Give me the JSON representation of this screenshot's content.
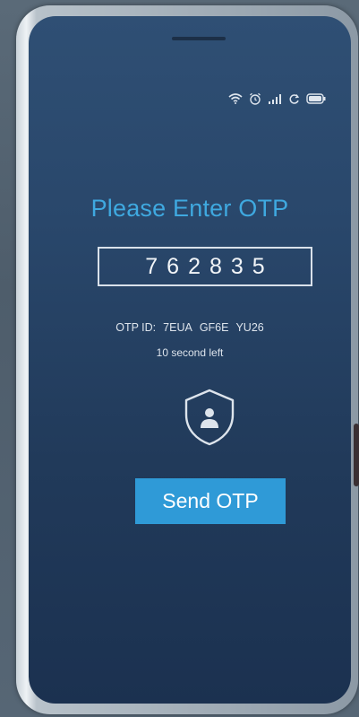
{
  "status_bar": {
    "icons": [
      "wifi-icon",
      "alarm-icon",
      "signal-icon",
      "sync-icon",
      "battery-icon"
    ]
  },
  "otp_screen": {
    "title": "Please Enter OTP",
    "otp_value": "762835",
    "otp_id_label": "OTP ID:",
    "otp_id_parts": [
      "7EUA",
      "GF6E",
      "YU26"
    ],
    "timer_text": "10 second left",
    "shield_icon": "shield-user-icon",
    "send_button_label": "Send OTP"
  },
  "colors": {
    "accent": "#3fa9e0",
    "button": "#2f9ad7",
    "screen_top": "#2f4f74",
    "screen_bottom": "#1b3150"
  }
}
